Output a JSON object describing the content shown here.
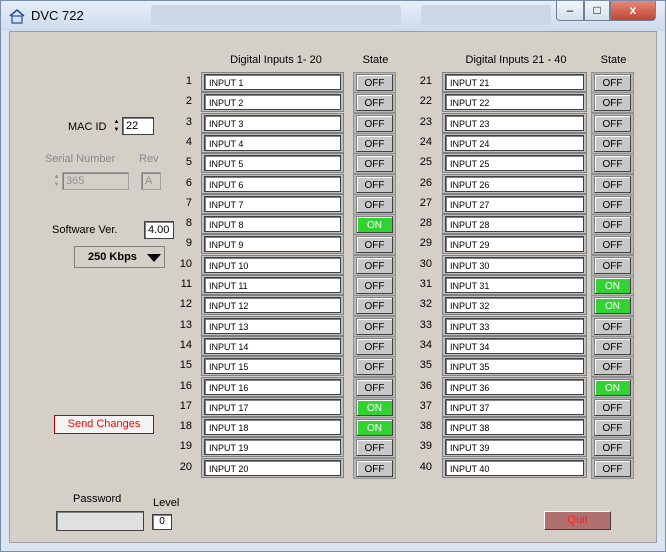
{
  "window": {
    "title": "DVC 722",
    "min_glyph": "–",
    "max_glyph": "□",
    "close_glyph": "x"
  },
  "sidebar": {
    "mac_id_label": "MAC ID",
    "mac_id_value": "22",
    "serial_label": "Serial Number",
    "serial_value": "365",
    "rev_label": "Rev",
    "rev_value": "A",
    "software_label": "Software Ver.",
    "software_value": "4.00",
    "baud_value": "250 Kbps",
    "send_label": "Send Changes",
    "password_label": "Password",
    "level_label": "Level",
    "level_value": "0"
  },
  "group1": {
    "header": "Digital Inputs 1- 20",
    "state_header": "State",
    "rows": [
      {
        "num": "1",
        "name": "INPUT  1",
        "state": "OFF"
      },
      {
        "num": "2",
        "name": "INPUT  2",
        "state": "OFF"
      },
      {
        "num": "3",
        "name": "INPUT  3",
        "state": "OFF"
      },
      {
        "num": "4",
        "name": "INPUT  4",
        "state": "OFF"
      },
      {
        "num": "5",
        "name": "INPUT  5",
        "state": "OFF"
      },
      {
        "num": "6",
        "name": "INPUT  6",
        "state": "OFF"
      },
      {
        "num": "7",
        "name": "INPUT  7",
        "state": "OFF"
      },
      {
        "num": "8",
        "name": "INPUT  8",
        "state": "ON"
      },
      {
        "num": "9",
        "name": "INPUT  9",
        "state": "OFF"
      },
      {
        "num": "10",
        "name": "INPUT  10",
        "state": "OFF"
      },
      {
        "num": "11",
        "name": "INPUT  11",
        "state": "OFF"
      },
      {
        "num": "12",
        "name": "INPUT  12",
        "state": "OFF"
      },
      {
        "num": "13",
        "name": "INPUT  13",
        "state": "OFF"
      },
      {
        "num": "14",
        "name": "INPUT  14",
        "state": "OFF"
      },
      {
        "num": "15",
        "name": "INPUT  15",
        "state": "OFF"
      },
      {
        "num": "16",
        "name": "INPUT  16",
        "state": "OFF"
      },
      {
        "num": "17",
        "name": "INPUT  17",
        "state": "ON"
      },
      {
        "num": "18",
        "name": "INPUT  18",
        "state": "ON"
      },
      {
        "num": "19",
        "name": "INPUT  19",
        "state": "OFF"
      },
      {
        "num": "20",
        "name": "INPUT  20",
        "state": "OFF"
      }
    ]
  },
  "group2": {
    "header": "Digital Inputs 21 - 40",
    "state_header": "State",
    "rows": [
      {
        "num": "21",
        "name": "INPUT  21",
        "state": "OFF"
      },
      {
        "num": "22",
        "name": "INPUT  22",
        "state": "OFF"
      },
      {
        "num": "23",
        "name": "INPUT  23",
        "state": "OFF"
      },
      {
        "num": "24",
        "name": "INPUT  24",
        "state": "OFF"
      },
      {
        "num": "25",
        "name": "INPUT  25",
        "state": "OFF"
      },
      {
        "num": "26",
        "name": "INPUT  26",
        "state": "OFF"
      },
      {
        "num": "27",
        "name": "INPUT  27",
        "state": "OFF"
      },
      {
        "num": "28",
        "name": "INPUT  28",
        "state": "OFF"
      },
      {
        "num": "29",
        "name": "INPUT  29",
        "state": "OFF"
      },
      {
        "num": "30",
        "name": "INPUT  30",
        "state": "OFF"
      },
      {
        "num": "31",
        "name": "INPUT  31",
        "state": "ON"
      },
      {
        "num": "32",
        "name": "INPUT  32",
        "state": "ON"
      },
      {
        "num": "33",
        "name": "INPUT  33",
        "state": "OFF"
      },
      {
        "num": "34",
        "name": "INPUT  34",
        "state": "OFF"
      },
      {
        "num": "35",
        "name": "INPUT  35",
        "state": "OFF"
      },
      {
        "num": "36",
        "name": "INPUT  36",
        "state": "ON"
      },
      {
        "num": "37",
        "name": "INPUT  37",
        "state": "OFF"
      },
      {
        "num": "38",
        "name": "INPUT  38",
        "state": "OFF"
      },
      {
        "num": "39",
        "name": "INPUT  39",
        "state": "OFF"
      },
      {
        "num": "40",
        "name": "INPUT  40",
        "state": "OFF"
      }
    ]
  },
  "footer": {
    "quit_label": "Quit"
  },
  "colors": {
    "on": "#32d232",
    "send_text": "#ff0000",
    "quit_bg": "#b07070"
  }
}
